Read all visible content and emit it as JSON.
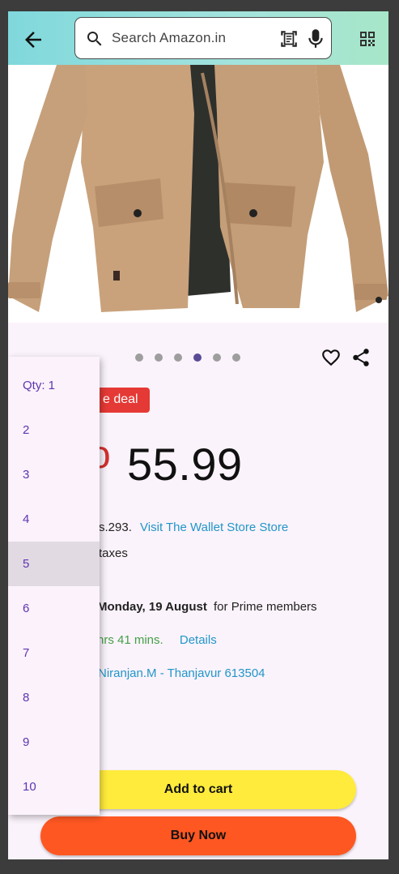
{
  "header": {
    "search_placeholder": "Search Amazon.in"
  },
  "icons": {
    "back": "arrow-back-icon",
    "search": "search-icon",
    "scan": "document-scanner-icon",
    "mic": "mic-icon",
    "qr": "qr-code-icon",
    "heart": "heart-outline-icon",
    "share": "share-icon"
  },
  "carousel": {
    "dot_count": 6,
    "active_index": 3
  },
  "deal_badge": "e deal",
  "discount_fragment": "o",
  "price": "55.99",
  "lines": {
    "mrp_fragment": "s.293.",
    "store_link": "Visit The Wallet Store Store",
    "taxes": "taxes",
    "delivery_date": "Monday, 19 August",
    "delivery_suffix": "for Prime members",
    "countdown": "hrs 41 mins.",
    "details_link": "Details",
    "address_link": "Niranjan.M - Thanjavur 613504"
  },
  "buttons": {
    "add_to_cart": "Add to cart",
    "buy_now": "Buy Now"
  },
  "qty_menu": {
    "selected": "5",
    "items": [
      "Qty: 1",
      "2",
      "3",
      "4",
      "5",
      "6",
      "7",
      "8",
      "9",
      "10"
    ]
  },
  "colors": {
    "accent_purple": "#5e35b1",
    "link_blue": "#2196c9",
    "deal_red": "#e53935",
    "cart_yellow": "#ffeb3b",
    "buy_orange": "#ff5722",
    "countdown_green": "#43a047"
  }
}
